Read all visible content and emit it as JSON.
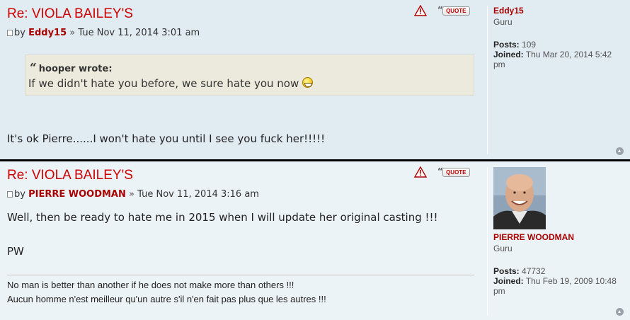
{
  "posts": [
    {
      "title": "Re: VIOLA BAILEY'S",
      "by_prefix": "by",
      "author": "Eddy15",
      "separator": "»",
      "date": "Tue Nov 11, 2014 3:01 am",
      "quote_button": "QUOTE",
      "quote": {
        "author_line": "hooper wrote:",
        "text": "If we didn't hate you before, we sure hate you now"
      },
      "body": "It's ok Pierre......I won't hate you until I see you fuck her!!!!!",
      "profile": {
        "username": "Eddy15",
        "rank": "Guru",
        "posts_label": "Posts:",
        "posts_value": "109",
        "joined_label": "Joined:",
        "joined_value": "Thu Mar 20, 2014 5:42 pm"
      }
    },
    {
      "title": "Re: VIOLA BAILEY'S",
      "by_prefix": "by",
      "author": "PIERRE WOODMAN",
      "separator": "»",
      "date": "Tue Nov 11, 2014 3:16 am",
      "quote_button": "QUOTE",
      "body_line1": "Well, then be ready to hate me in 2015 when I will update her original casting !!!",
      "body_line2": "PW",
      "signature_line1": "No man is better than another if he does not make more than others !!!",
      "signature_line2": "Aucun homme n'est meilleur qu'un autre s'il n'en fait pas plus que les autres !!!",
      "profile": {
        "username": "PIERRE WOODMAN",
        "rank": "Guru",
        "posts_label": "Posts:",
        "posts_value": "47732",
        "joined_label": "Joined:",
        "joined_value": "Thu Feb 19, 2009 10:48 pm"
      }
    }
  ],
  "colors": {
    "post1_bg": "#e1ebf2",
    "post2_bg": "#ecf3f7",
    "title": "#cc0000",
    "author": "#aa0000"
  }
}
